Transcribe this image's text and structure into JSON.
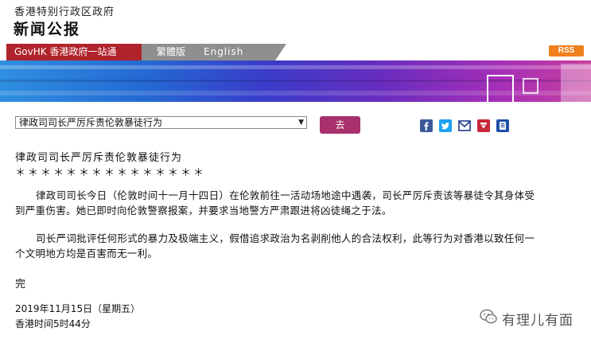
{
  "header": {
    "department": "香港特别行政区政府",
    "title": "新闻公报"
  },
  "nav": {
    "gov_link": "GovHK 香港政府一站通",
    "traditional": "繁體版",
    "english": "English",
    "rss": "RSS"
  },
  "toolbar": {
    "select_value": "律政司司长严厉斥责伦敦暴徒行为",
    "go_label": "去",
    "share_icons": [
      "facebook-icon",
      "twitter-icon",
      "email-icon",
      "bookmark-icon",
      "print-icon"
    ]
  },
  "article": {
    "title": "律政司司长严厉斥责伦敦暴徒行为",
    "separator": "＊＊＊＊＊＊＊＊＊＊＊＊＊＊＊",
    "paragraph1": "律政司司长今日（伦敦时间十一月十四日）在伦敦前往一活动场地途中遇袭，司长严厉斥责该等暴徒令其身体受到严重伤害。她已即时向伦敦警察报案，并要求当地警方严肃跟进将凶徒绳之于法。",
    "paragraph2": "司长严词批评任何形式的暴力及极端主义，假借追求政治为名剥削他人的合法权利，此等行为对香港以致任何一个文明地方均是百害而无一利。",
    "end": "完",
    "date": "2019年11月15日（星期五）",
    "time": "香港时间5时44分"
  },
  "watermark": {
    "text": "有理儿有面"
  },
  "colors": {
    "gov_red": "#b0232a",
    "go_button": "#a8316b",
    "rss_orange": "#f07f1e"
  }
}
